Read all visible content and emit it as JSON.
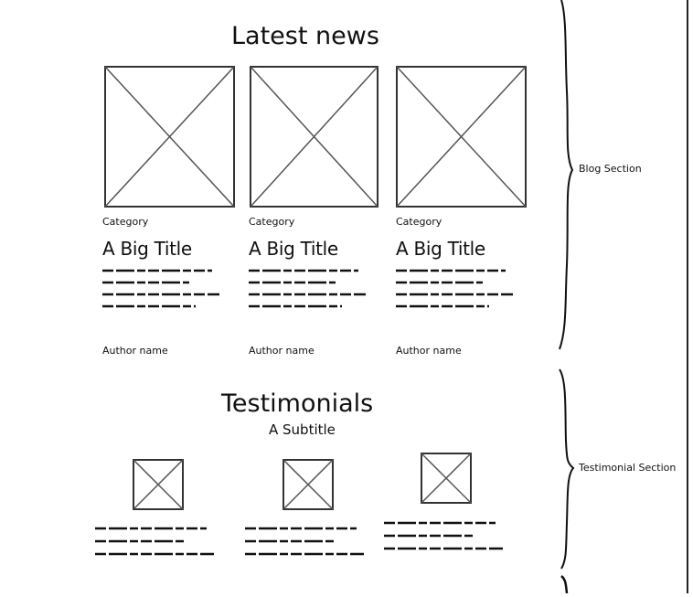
{
  "blog": {
    "heading": "Latest news",
    "cards": [
      {
        "category": "Category",
        "title": "A Big Title",
        "author": "Author name"
      },
      {
        "category": "Category",
        "title": "A Big Title",
        "author": "Author name"
      },
      {
        "category": "Category",
        "title": "A Big Title",
        "author": "Author name"
      }
    ]
  },
  "testimonials": {
    "heading": "Testimonials",
    "subtitle": "A Subtitle"
  },
  "annotations": {
    "blog_section": "Blog Section",
    "testimonial_section": "Testimonial Section"
  }
}
